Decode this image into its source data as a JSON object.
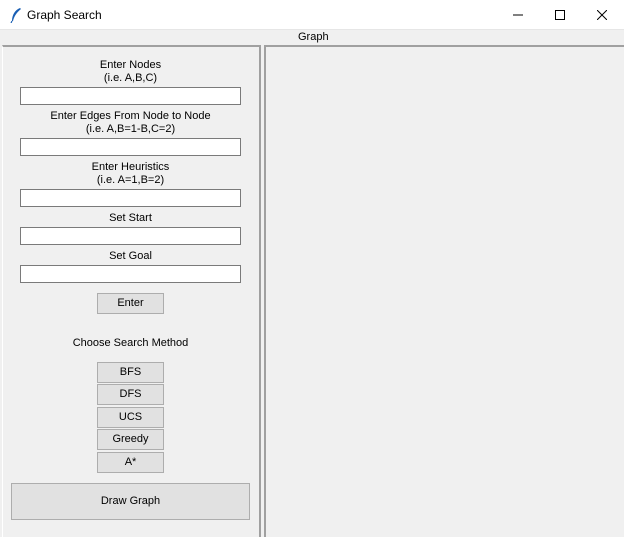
{
  "window": {
    "title": "Graph Search",
    "icon": "feather-icon"
  },
  "graph_panel": {
    "label": "Graph"
  },
  "form": {
    "nodes_label": "Enter Nodes",
    "nodes_hint": "(i.e. A,B,C)",
    "nodes_value": "",
    "edges_label": "Enter Edges From Node to Node",
    "edges_hint": "(i.e. A,B=1-B,C=2)",
    "edges_value": "",
    "heuristics_label": "Enter Heuristics",
    "heuristics_hint": "(i.e. A=1,B=2)",
    "heuristics_value": "",
    "start_label": "Set Start",
    "start_value": "",
    "goal_label": "Set Goal",
    "goal_value": "",
    "enter_button": "Enter"
  },
  "search": {
    "heading": "Choose Search Method",
    "methods": [
      "BFS",
      "DFS",
      "UCS",
      "Greedy",
      "A*"
    ]
  },
  "draw_button": "Draw Graph"
}
